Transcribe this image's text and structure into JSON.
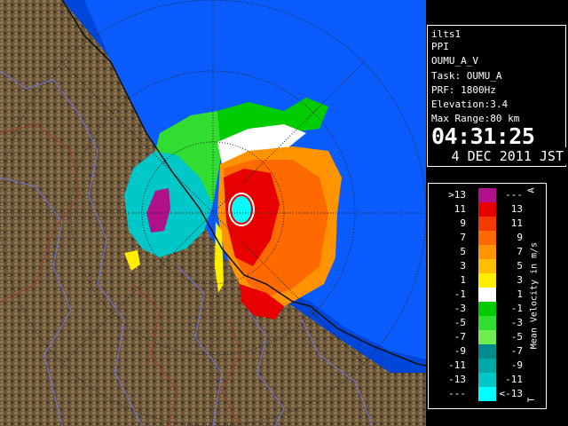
{
  "info": {
    "station": "ilts1",
    "product": "PPI",
    "scan": "OUMU_A_V",
    "task": "Task: OUMU_A",
    "prf": "PRF: 1800Hz",
    "elevation": "Elevation:3.4",
    "max_range": "Max Range:80 km",
    "time": "04:31:25",
    "date": "4 DEC 2011 JST"
  },
  "legend": {
    "title": "Mean Velocity in m/s",
    "corner_top": "A",
    "corner_bottom": "T",
    "rows": [
      {
        "lo": ">13",
        "hi": "---",
        "color": "#b0108a"
      },
      {
        "lo": "11",
        "hi": "13",
        "color": "#e80000"
      },
      {
        "lo": "9",
        "hi": "11",
        "color": "#f43a00"
      },
      {
        "lo": "7",
        "hi": "9",
        "color": "#ff6a00"
      },
      {
        "lo": "5",
        "hi": "7",
        "color": "#ff9400"
      },
      {
        "lo": "3",
        "hi": "5",
        "color": "#ffbe00"
      },
      {
        "lo": "1",
        "hi": "3",
        "color": "#ffee00"
      },
      {
        "lo": "-1",
        "hi": "1",
        "color": "#ffffff"
      },
      {
        "lo": "-3",
        "hi": "-1",
        "color": "#00cc00"
      },
      {
        "lo": "-5",
        "hi": "-3",
        "color": "#30dd30"
      },
      {
        "lo": "-7",
        "hi": "-5",
        "color": "#70ee50"
      },
      {
        "lo": "-9",
        "hi": "-7",
        "color": "#008c8c"
      },
      {
        "lo": "-11",
        "hi": "-9",
        "color": "#00a8a8"
      },
      {
        "lo": "-13",
        "hi": "-11",
        "color": "#00c8c8"
      },
      {
        "lo": "---",
        "hi": "<-13",
        "color": "#00ffff"
      }
    ]
  },
  "colors": {
    "range_blue": "#0a5cff",
    "outer_blue": "#0046d8",
    "land": "#6e5a40",
    "sea": "#0a5cff"
  }
}
